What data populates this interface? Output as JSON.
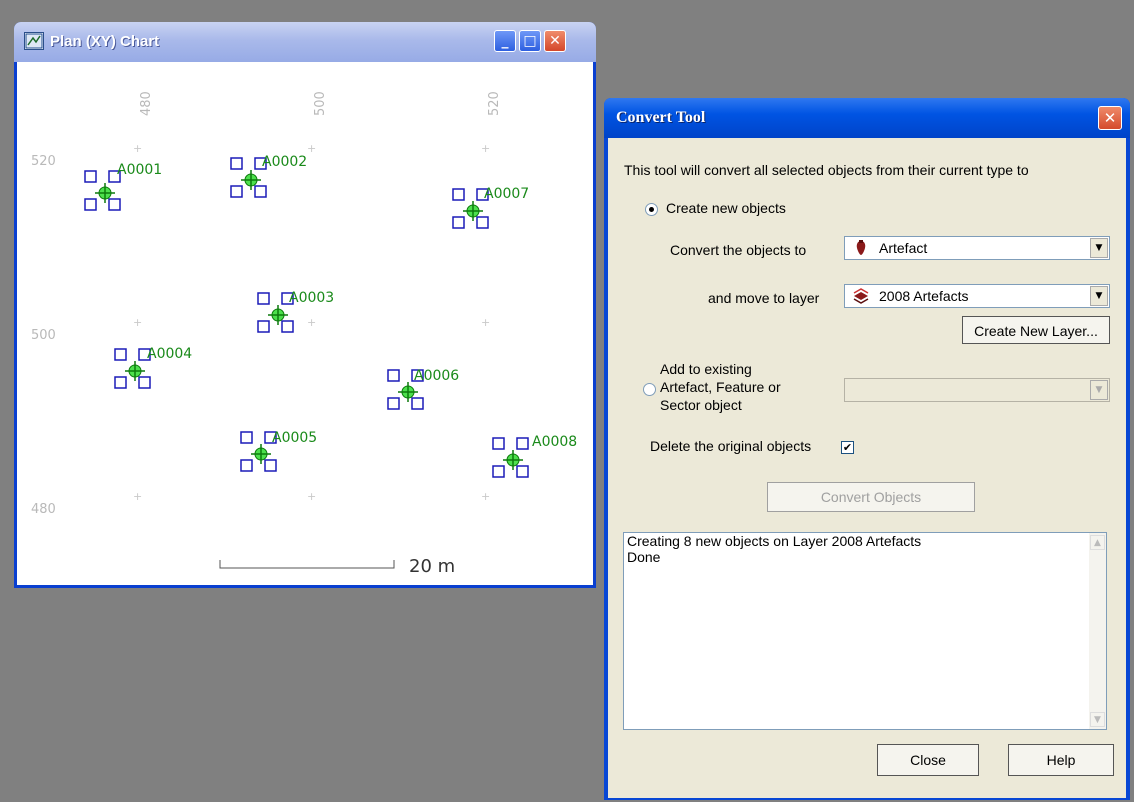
{
  "plan_window": {
    "title": "Plan (XY) Chart",
    "buttons": {
      "minimize": "_",
      "maximize": "□",
      "close": "✕"
    },
    "x_ticks": [
      "480",
      "500",
      "520"
    ],
    "y_ticks": [
      "520",
      "500",
      "480"
    ],
    "scale_label": "20 m",
    "markers": [
      "A0001",
      "A0002",
      "A0003",
      "A0004",
      "A0005",
      "A0006",
      "A0007",
      "A0008"
    ]
  },
  "dialog": {
    "title": "Convert Tool",
    "close": "✕",
    "description": "This tool will convert all selected objects from their current type to",
    "option_create": "Create new objects",
    "convert_to_label": "Convert the objects to",
    "convert_to_value": "Artefact",
    "move_layer_label": "and move to layer",
    "move_layer_value": "2008 Artefacts",
    "create_layer_button": "Create New Layer...",
    "option_add_line1": "Add to existing",
    "option_add_line2": "Artefact, Feature or",
    "option_add_line3": "Sector object",
    "delete_label": "Delete the original objects",
    "delete_checked": "✔",
    "convert_button": "Convert Objects",
    "log": [
      "Creating 8 new objects on Layer 2008 Artefacts",
      "Done"
    ],
    "close_button": "Close",
    "help_button": "Help"
  }
}
